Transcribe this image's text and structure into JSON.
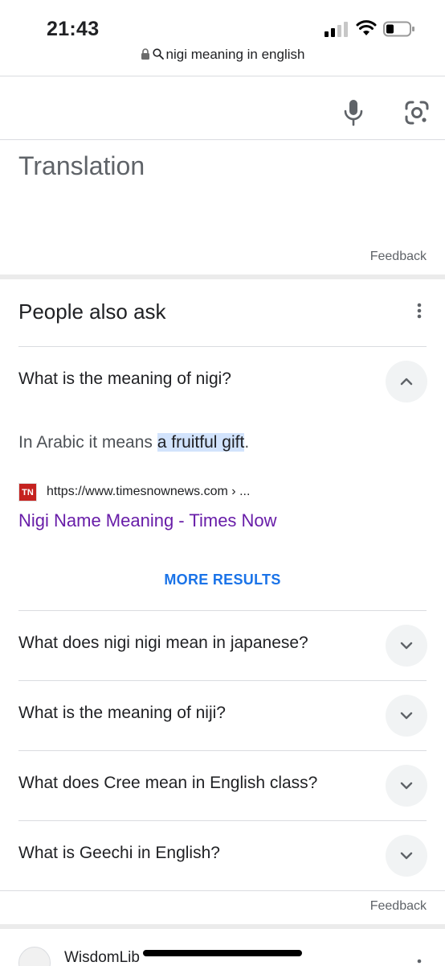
{
  "status_bar": {
    "time": "21:43"
  },
  "url_bar": {
    "query": "nigi meaning in english"
  },
  "translation": {
    "title": "Translation",
    "feedback": "Feedback"
  },
  "people_also_ask": {
    "title": "People also ask",
    "expanded": {
      "question": "What is the meaning of nigi?",
      "answer_prefix": "In Arabic it means ",
      "answer_highlight": "a fruitful gift",
      "answer_suffix": ".",
      "source_favicon_text": "TN",
      "source_url": "https://www.timesnownews.com › ...",
      "source_title": "Nigi Name Meaning - Times Now"
    },
    "more_results": "MORE RESULTS",
    "questions": [
      "What does nigi nigi mean in japanese?",
      "What is the meaning of niji?",
      "What does Cree mean in English class?",
      "What is Geechi in English?"
    ],
    "feedback": "Feedback"
  },
  "next_result": {
    "site_name": "WisdomLib"
  },
  "colors": {
    "link_visited": "#681da8",
    "accent_blue": "#1a73e8",
    "highlight": "#d2e3fc",
    "favicon_red": "#c5221f"
  },
  "icons": [
    "lock-icon",
    "search-icon",
    "mic-icon",
    "lens-icon",
    "kebab-menu-icon",
    "chevron-up-icon",
    "chevron-down-icon"
  ]
}
